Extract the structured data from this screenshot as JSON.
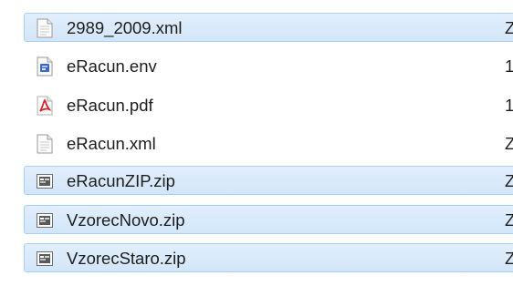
{
  "files": [
    {
      "name": "2989_2009.xml",
      "col2": "Z",
      "icon": "text-document-icon",
      "selected": true
    },
    {
      "name": "eRacun.env",
      "col2": "1",
      "icon": "env-file-icon",
      "selected": false
    },
    {
      "name": "eRacun.pdf",
      "col2": "1",
      "icon": "pdf-icon",
      "selected": false
    },
    {
      "name": "eRacun.xml",
      "col2": "Z",
      "icon": "text-document-icon",
      "selected": false
    },
    {
      "name": "eRacunZIP.zip",
      "col2": "Z",
      "icon": "zip-archive-icon",
      "selected": true
    },
    {
      "name": "VzorecNovo.zip",
      "col2": "Z",
      "icon": "zip-archive-icon",
      "selected": true
    },
    {
      "name": "VzorecStaro.zip",
      "col2": "Z",
      "icon": "zip-archive-icon",
      "selected": true
    }
  ],
  "colors": {
    "selection_background": "#dbeafa",
    "selection_border": "#a9cff6",
    "text": "#1e1e1e"
  }
}
